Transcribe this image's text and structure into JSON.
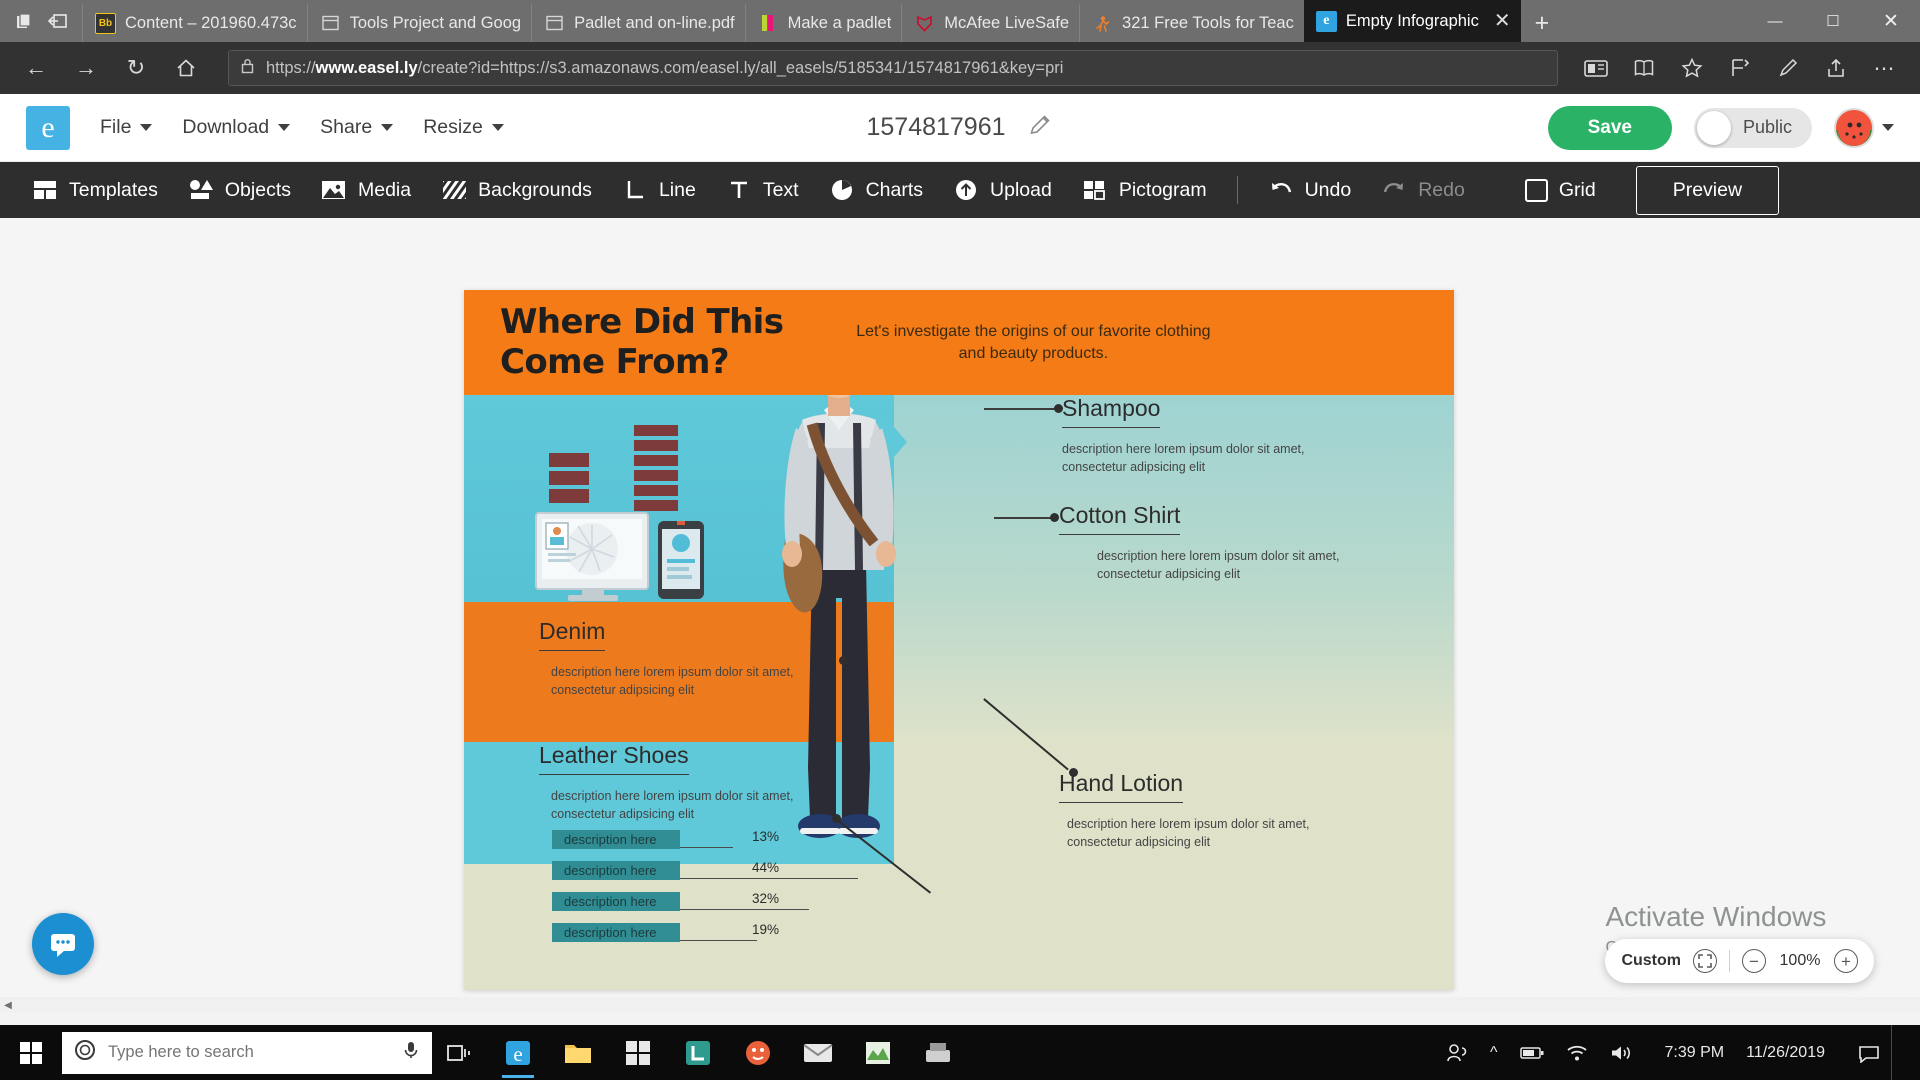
{
  "browser": {
    "tabs": [
      {
        "title": "Content – 201960.473c",
        "favicon": "blackboard-icon",
        "active": false
      },
      {
        "title": "Tools Project and Goog",
        "favicon": "window-icon",
        "active": false
      },
      {
        "title": "Padlet and on-line.pdf",
        "favicon": "window-icon",
        "active": false
      },
      {
        "title": "Make a padlet",
        "favicon": "padlet-icon",
        "active": false
      },
      {
        "title": "McAfee LiveSafe",
        "favicon": "mcafee-icon",
        "active": false
      },
      {
        "title": "321 Free Tools for Teac",
        "favicon": "person-icon",
        "active": false
      },
      {
        "title": "Empty Infographic",
        "favicon": "edge-icon",
        "active": true
      }
    ],
    "new_tab_label": "+",
    "window_controls": {
      "minimize": "—",
      "maximize": "☐",
      "close": "✕"
    },
    "nav": {
      "back": "←",
      "forward": "→",
      "refresh": "↻",
      "home": "⌂",
      "lock_icon": "lock-icon",
      "url_prefix": "https://",
      "url_bold": "www.easel.ly",
      "url_rest": "/create?id=https://s3.amazonaws.com/easel.ly/all_easels/5185341/1574817961&key=pri",
      "reading_view": "reading-view-icon",
      "book": "book-icon",
      "favorite_star": "star-icon",
      "favorites_hub": "favorites-icon",
      "notes": "pen-icon",
      "share": "share-icon",
      "settings": "ellipsis-icon"
    }
  },
  "app": {
    "logo_letter": "e",
    "menus": [
      {
        "label": "File"
      },
      {
        "label": "Download"
      },
      {
        "label": "Share"
      },
      {
        "label": "Resize"
      }
    ],
    "document_title": "1574817961",
    "edit_title_icon": "pencil-icon",
    "save_label": "Save",
    "visibility_label": "Public",
    "avatar_name": "user-avatar",
    "avatar_caret": "chevron-down-icon"
  },
  "toolbar": {
    "items": [
      {
        "label": "Templates",
        "icon": "templates-icon",
        "dim": false
      },
      {
        "label": "Objects",
        "icon": "objects-icon",
        "dim": false
      },
      {
        "label": "Media",
        "icon": "media-icon",
        "dim": false
      },
      {
        "label": "Backgrounds",
        "icon": "backgrounds-icon",
        "dim": false
      },
      {
        "label": "Line",
        "icon": "line-icon",
        "dim": false
      },
      {
        "label": "Text",
        "icon": "text-icon",
        "dim": false
      },
      {
        "label": "Charts",
        "icon": "charts-icon",
        "dim": false
      },
      {
        "label": "Upload",
        "icon": "upload-icon",
        "dim": false
      },
      {
        "label": "Pictogram",
        "icon": "pictogram-icon",
        "dim": false
      }
    ],
    "undo_label": "Undo",
    "redo_label": "Redo",
    "grid_label": "Grid",
    "preview_label": "Preview"
  },
  "infographic": {
    "title_line1": "Where Did This",
    "title_line2": "Come From?",
    "subtitle": "Let's investigate the origins of our favorite clothing and beauty products.",
    "labels": [
      {
        "name": "Shampoo",
        "desc": "description here lorem ipsum dolor sit amet, consectetur adipsicing elit"
      },
      {
        "name": "Cotton Shirt",
        "desc": "description here lorem ipsum dolor sit amet, consectetur adipsicing elit"
      },
      {
        "name": "Denim",
        "desc": "description here lorem ipsum dolor sit amet, consectetur adipsicing elit"
      },
      {
        "name": "Hand Lotion",
        "desc": "description here lorem ipsum dolor sit amet, consectetur adipsicing elit"
      },
      {
        "name": "Leather Shoes",
        "desc": "description here lorem ipsum dolor sit amet, consectetur adipsicing elit"
      }
    ],
    "colors": {
      "header_orange": "#f47b16",
      "band_orange": "#ee7a1e",
      "band_teal": "#5fc8d9",
      "band_cream": "#dfe2c9",
      "bar_fill": "#2f8d93"
    },
    "chart_data": {
      "type": "bar",
      "title": "Leather Shoes",
      "orientation": "horizontal",
      "categories": [
        "description here",
        "description here",
        "description here",
        "description here"
      ],
      "values": [
        13,
        44,
        32,
        19
      ],
      "value_labels": [
        "13%",
        "44%",
        "32%",
        "19%"
      ],
      "xlabel": "",
      "ylabel": "",
      "xlim": [
        0,
        100
      ],
      "grid": false,
      "legend": false
    }
  },
  "zoom_control": {
    "custom_label": "Custom",
    "fit_icon": "fit-screen-icon",
    "zoom_out_icon": "minus-icon",
    "zoom_in_icon": "plus-icon",
    "level": "100%"
  },
  "watermark": {
    "line1": "Activate Windows",
    "line2": "Go to Settings to activate Windows."
  },
  "chat_widget": {
    "icon": "chat-icon"
  },
  "taskbar": {
    "start_icon": "windows-icon",
    "search_placeholder": "Type here to search",
    "mic_icon": "microphone-icon",
    "task_view_icon": "task-view-icon",
    "apps": [
      {
        "icon": "edge-icon",
        "name": "microsoft-edge",
        "open": true
      },
      {
        "icon": "explorer-icon",
        "name": "file-explorer",
        "open": false
      },
      {
        "icon": "store-icon",
        "name": "microsoft-store",
        "open": false
      },
      {
        "icon": "lockdown-icon",
        "name": "lockdown-browser",
        "open": false
      },
      {
        "icon": "respondus-icon",
        "name": "respondus",
        "open": false
      },
      {
        "icon": "mail-icon",
        "name": "mail",
        "open": false
      },
      {
        "icon": "excel-icon",
        "name": "excel",
        "open": false
      },
      {
        "icon": "scanner-icon",
        "name": "scanner",
        "open": false
      }
    ],
    "tray": [
      {
        "icon": "people-icon",
        "name": "people"
      },
      {
        "icon": "chevron-up-icon",
        "name": "show-hidden-icons"
      },
      {
        "icon": "battery-icon",
        "name": "battery"
      },
      {
        "icon": "wifi-icon",
        "name": "network"
      },
      {
        "icon": "volume-icon",
        "name": "volume"
      }
    ],
    "time": "7:39 PM",
    "date": "11/26/2019",
    "notification_icon": "notifications-icon"
  }
}
